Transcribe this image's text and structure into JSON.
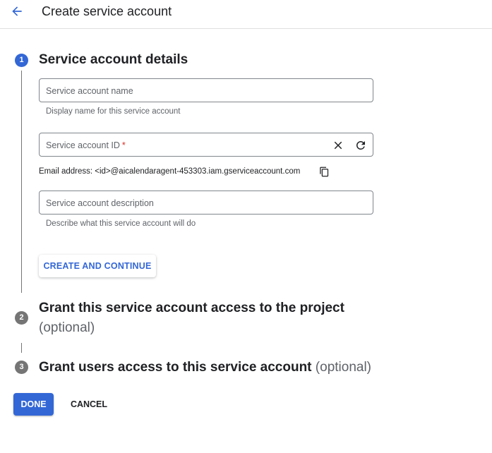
{
  "header": {
    "back_icon": "arrow-back-icon",
    "title": "Create service account"
  },
  "colors": {
    "accent": "#3367d6",
    "step_inactive": "#757575",
    "required": "#d93025"
  },
  "steps": [
    {
      "number": "1",
      "title": "Service account details",
      "optional": "",
      "state": "active"
    },
    {
      "number": "2",
      "title": "Grant this service account access to the project",
      "optional": "(optional)",
      "state": "inactive"
    },
    {
      "number": "3",
      "title": "Grant users access to this service account",
      "optional": "(optional)",
      "state": "inactive"
    }
  ],
  "form": {
    "name_field": {
      "placeholder": "Service account name",
      "value": "",
      "hint": "Display name for this service account"
    },
    "id_field": {
      "placeholder": "Service account ID",
      "required_mark": "*",
      "value": "",
      "clear_icon": "close-icon",
      "refresh_icon": "refresh-icon"
    },
    "email": {
      "text": "Email address: <id>@aicalendaragent-453303.iam.gserviceaccount.com",
      "copy_icon": "copy-icon"
    },
    "description_field": {
      "placeholder": "Service account description",
      "value": "",
      "hint": "Describe what this service account will do"
    },
    "create_button": "CREATE AND CONTINUE"
  },
  "footer": {
    "done_button": "DONE",
    "cancel_button": "CANCEL"
  }
}
